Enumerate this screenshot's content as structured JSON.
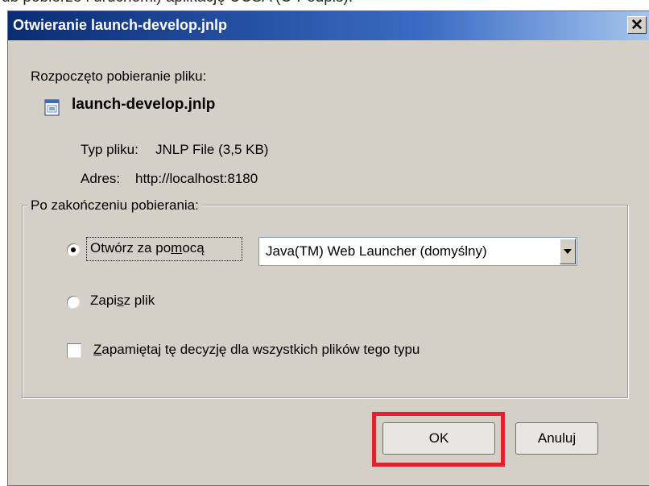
{
  "page_caption_fragment": "ub pobierze i uruchomi) aplikację UCSA (C-Podpis).",
  "dialog": {
    "title": "Otwieranie launch-develop.jnlp",
    "close_icon": "close-icon",
    "intro": "Rozpoczęto pobieranie pliku:",
    "file": {
      "icon": "jnlp-file-icon",
      "name": "launch-develop.jnlp",
      "type_label": "Typ pliku:",
      "type_value": "JNLP File (3,5 KB)",
      "address_label": "Adres:",
      "address_value": "http://localhost:8180"
    },
    "group": {
      "legend": "Po zakończeniu pobierania:",
      "open_with": {
        "label_before": "Otwórz za po",
        "label_accel": "m",
        "label_after": "ocą",
        "selected": true
      },
      "app_select": {
        "value": "Java(TM) Web Launcher (domyślny)"
      },
      "save_file": {
        "label_before": "Zapi",
        "label_accel": "s",
        "label_after": "z plik",
        "selected": false
      },
      "remember": {
        "label_before": "",
        "label_accel": "Z",
        "label_after": "apamiętaj tę decyzję dla wszystkich plików tego typu",
        "checked": false
      }
    },
    "buttons": {
      "ok": "OK",
      "cancel": "Anuluj"
    }
  },
  "colors": {
    "highlight": "#e0232e",
    "titlebar": "#0a2c73",
    "dialog_bg": "#d4d0c8"
  }
}
